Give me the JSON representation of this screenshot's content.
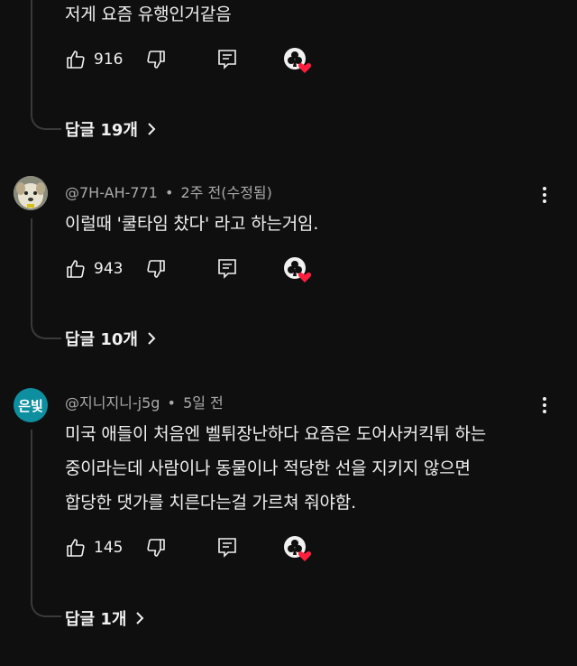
{
  "comments": [
    {
      "handle": "",
      "time": "",
      "text_lines": [
        "저게 요즘 유행인거같음"
      ],
      "likes": "916",
      "replies_label": "답글 19개"
    },
    {
      "handle": "@7H-AH-771",
      "time": "2주 전(수정됨)",
      "text_lines": [
        "이럴때 '쿨타임 찼다' 라고 하는거임."
      ],
      "likes": "943",
      "replies_label": "답글 10개",
      "avatar_icon": "dog-photo-avatar"
    },
    {
      "handle": "@지니지니-j5g",
      "time": "5일 전",
      "text_lines": [
        "미국 애들이 처음엔 벨튀장난하다 요즘은 도어사커킥튀 하는",
        "중이라는데 사람이나 동물이나 적당한 선을 지키지 않으면",
        "합당한 댓가를 치른다는걸 가르쳐 줘야함."
      ],
      "likes": "145",
      "replies_label": "답글 1개",
      "avatar_text": "은빛",
      "avatar_color": "#0e8fa0"
    }
  ],
  "separator": "•",
  "colors": {
    "background": "#0f0f0f",
    "text": "#f1f1f1",
    "muted": "#aaaaaa",
    "heart": "#ff1f3d"
  }
}
